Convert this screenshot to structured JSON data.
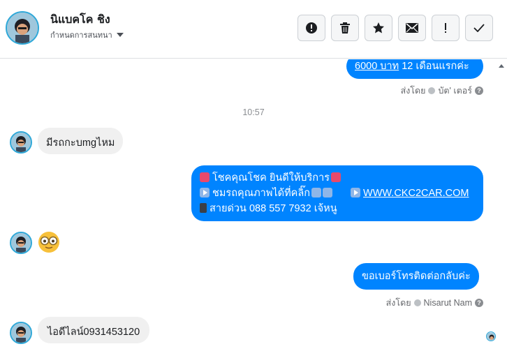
{
  "header": {
    "contact_name": "นิแบคโค ชิง",
    "assign_label": "กำหนดการสนทนา",
    "actions": [
      {
        "name": "report-button",
        "icon": "exclamation-circle-icon"
      },
      {
        "name": "delete-button",
        "icon": "trash-icon"
      },
      {
        "name": "star-button",
        "icon": "star-icon"
      },
      {
        "name": "mark-unread-button",
        "icon": "envelope-icon"
      },
      {
        "name": "follow-up-button",
        "icon": "exclamation-icon"
      },
      {
        "name": "mark-done-button",
        "icon": "check-icon"
      }
    ]
  },
  "messages": {
    "m1": {
      "link": "6000 บาท",
      "rest": " 12 เดือนแรกค่ะ"
    },
    "m1_sent_by": {
      "prefix": "ส่งโดย",
      "name": "บัต' เตอร์"
    },
    "time1": "10:57",
    "m2": "มีรถกะบmgไหม",
    "m3": {
      "line1": "โชคคุณโชค ยินดีให้บริการ",
      "line2": "ชมรถคุณภาพได้ที่คลิ๊ก",
      "line2_link": "WWW.CKC2CAR.COM",
      "line3": "สายด่วน 088 557 7932 เจ้หนู"
    },
    "m4_emoji": "nerd-glasses-emoji",
    "m5": "ขอเบอร์โทรติดต่อกลับค่ะ",
    "m5_sent_by": {
      "prefix": "ส่งโดย",
      "name": "Nisarut Nam"
    },
    "m6": "ไอดีไลน์0931453120"
  },
  "colors": {
    "outgoing_bubble": "#0084ff",
    "incoming_bubble": "#f0f0f0",
    "avatar_ring": "#2fa8d8"
  }
}
